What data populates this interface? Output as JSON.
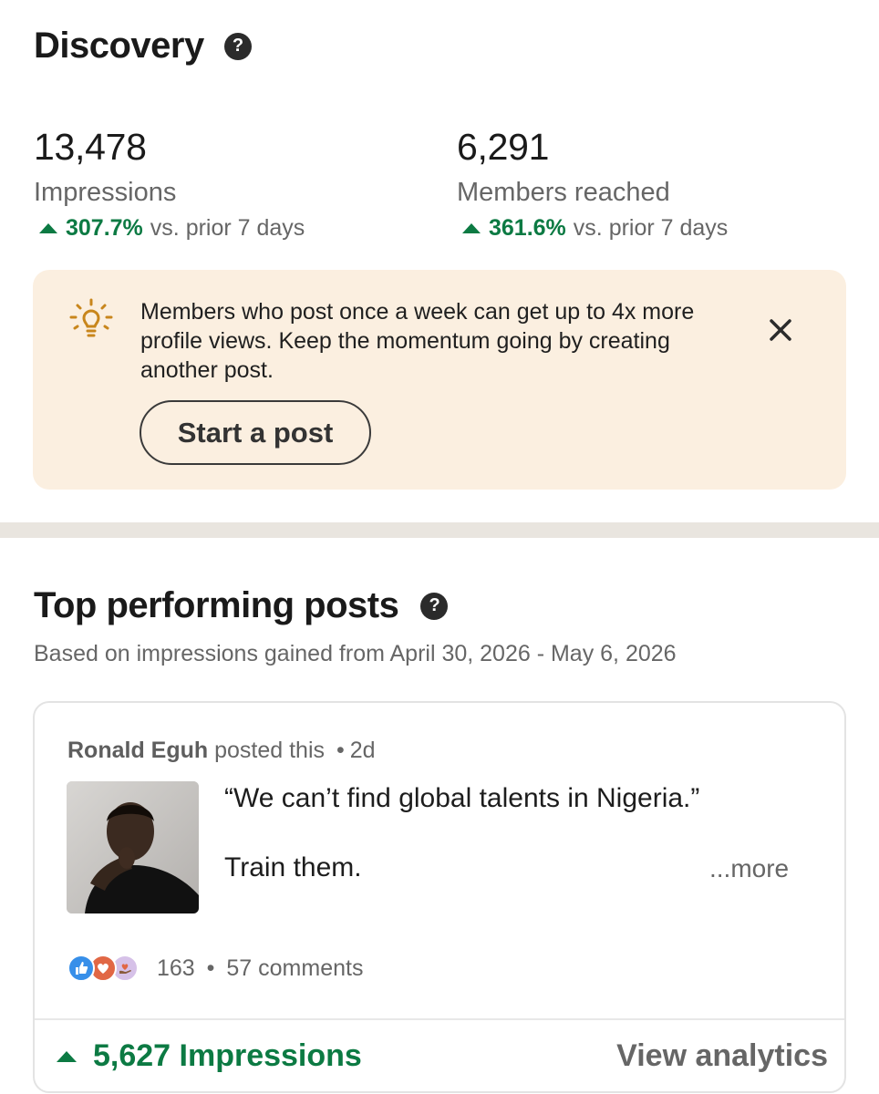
{
  "discovery": {
    "title": "Discovery",
    "help_icon": "question-circle-icon",
    "impressions": {
      "value": "13,478",
      "label": "Impressions",
      "change": "307.7%",
      "suffix": "vs. prior 7 days"
    },
    "members": {
      "value": "6,291",
      "label": "Members reached",
      "change": "361.6%",
      "suffix": "vs. prior 7 days"
    }
  },
  "tip": {
    "icon": "lightbulb-icon",
    "text": "Members who post once a week can get up to 4x more profile views. Keep the momentum going by creating another post.",
    "button": "Start a post",
    "close_icon": "close-icon"
  },
  "top_posts": {
    "title": "Top performing posts",
    "subtitle": "Based on impressions gained from April 30, 2026 - May 6, 2026",
    "post": {
      "author": "Ronald Eguh",
      "action": "posted this",
      "separator": "•",
      "age": "2d",
      "line1": "“We can’t find global talents in Nigeria.”",
      "line2": "Train them.",
      "more": "...more",
      "reaction_count": "163",
      "comments": "57 comments",
      "impressions": "5,627 Impressions",
      "view_analytics": "View analytics"
    }
  },
  "colors": {
    "accent_green": "#0c7a43",
    "tip_bg": "#fbefe0",
    "divider": "#e9e5df"
  }
}
